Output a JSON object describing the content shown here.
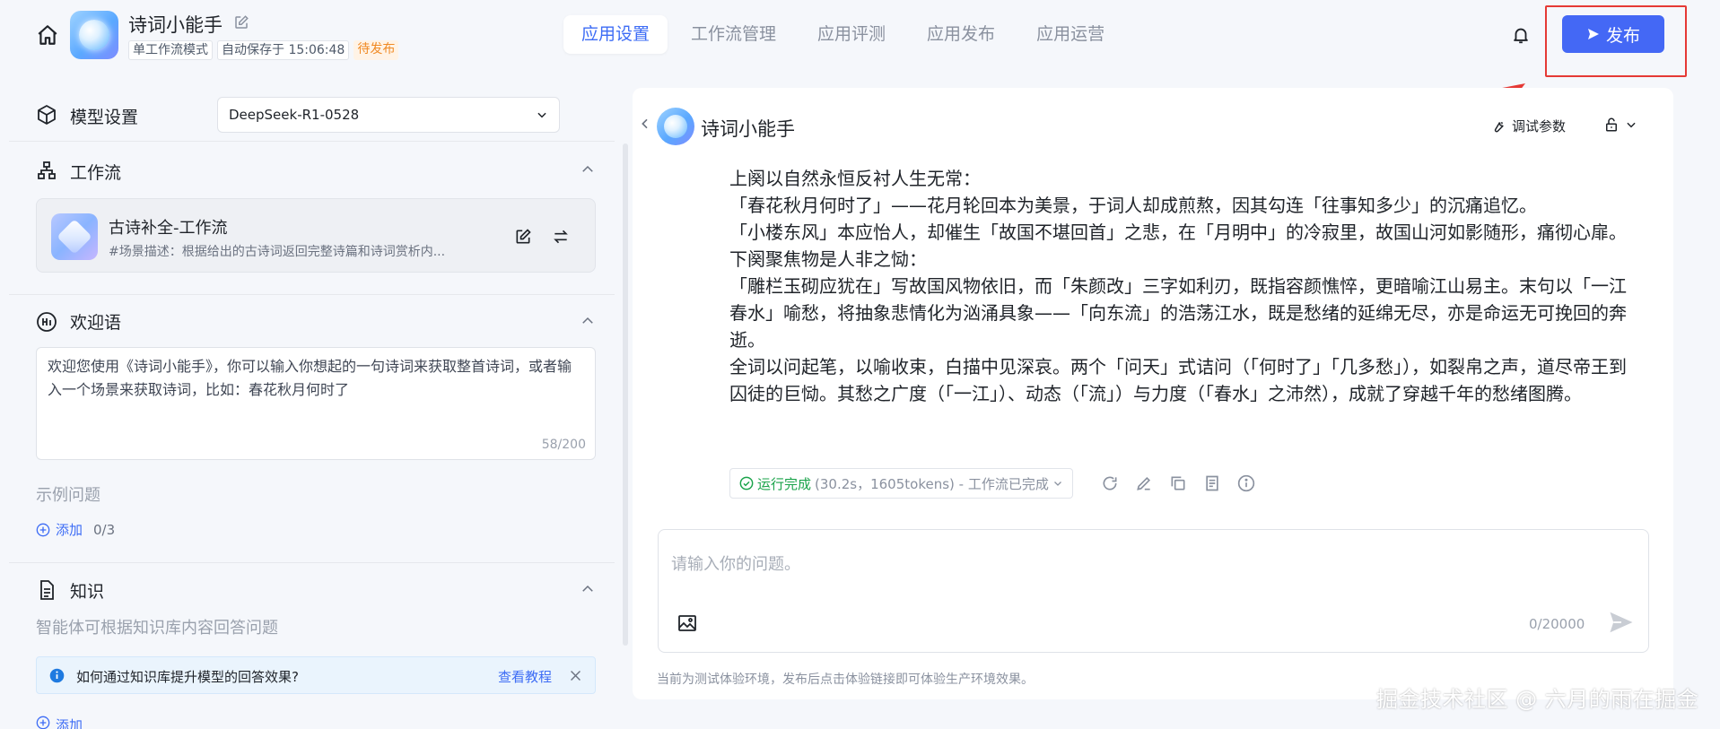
{
  "header": {
    "app_name": "诗词小能手",
    "mode_tag": "单工作流模式",
    "autosave": "自动保存于 15:06:48",
    "status_tag": "待发布",
    "tabs": [
      {
        "label": "应用设置",
        "active": true
      },
      {
        "label": "工作流管理",
        "active": false
      },
      {
        "label": "应用评测",
        "active": false
      },
      {
        "label": "应用发布",
        "active": false
      },
      {
        "label": "应用运营",
        "active": false
      }
    ],
    "publish_label": "发布",
    "accent_color": "#4468f5",
    "highlight_color": "#e53935"
  },
  "left": {
    "model": {
      "title": "模型设置",
      "selected": "DeepSeek-R1-0528"
    },
    "workflow": {
      "title": "工作流",
      "item_title": "古诗补全-工作流",
      "item_desc": "#场景描述：根据给出的古诗词返回完整诗篇和诗词赏析内..."
    },
    "welcome": {
      "title": "欢迎语",
      "text": "欢迎您使用《诗词小能手》，你可以输入你想起的一句诗词来获取整首诗词，或者输入一个场景来获取诗词，比如：春花秋月何时了",
      "count": "58/200"
    },
    "examples": {
      "title": "示例问题",
      "add_label": "添加",
      "count": "0/3"
    },
    "knowledge": {
      "title": "知识",
      "desc": "智能体可根据知识库内容回答问题",
      "tip": "如何通过知识库提升模型的回答效果?",
      "tutorial": "查看教程",
      "add_label": "添加"
    }
  },
  "chat": {
    "title": "诗词小能手",
    "debug_label": "调试参数",
    "answer_lines": [
      "上阕以自然永恒反衬人生无常：",
      "「春花秋月何时了」——花月轮回本为美景，于词人却成煎熬，因其勾连「往事知多少」的沉痛追忆。",
      "「小楼东风」本应怡人，却催生「故国不堪回首」之悲，在「月明中」的冷寂里，故国山河如影随形，痛彻心扉。",
      "下阕聚焦物是人非之恸：",
      "「雕栏玉砌应犹在」写故国风物依旧，而「朱颜改」三字如利刃，既指容颜憔悴，更暗喻江山易主。末句以「一江春水」喻愁，将抽象悲情化为汹涌具象——「向东流」的浩荡江水，既是愁绪的延绵无尽，亦是命运无可挽回的奔逝。",
      "全词以问起笔，以喻收束，白描中见深哀。两个「问天」式诘问（「何时了」「几多愁」），如裂帛之声，道尽帝王到囚徒的巨恸。其愁之广度（「一江」）、动态（「流」）与力度（「春水」之沛然），成就了穿越千年的愁绪图腾。"
    ],
    "run_status": "运行完成",
    "run_detail": "(30.2s，1605tokens) - 工作流已完成",
    "input_placeholder": "请输入你的问题。",
    "char_count": "0/20000",
    "env_note": "当前为测试体验环境，发布后点击体验链接即可体验生产环境效果。"
  },
  "watermark": "掘金技术社区 @ 六月的雨在掘金"
}
